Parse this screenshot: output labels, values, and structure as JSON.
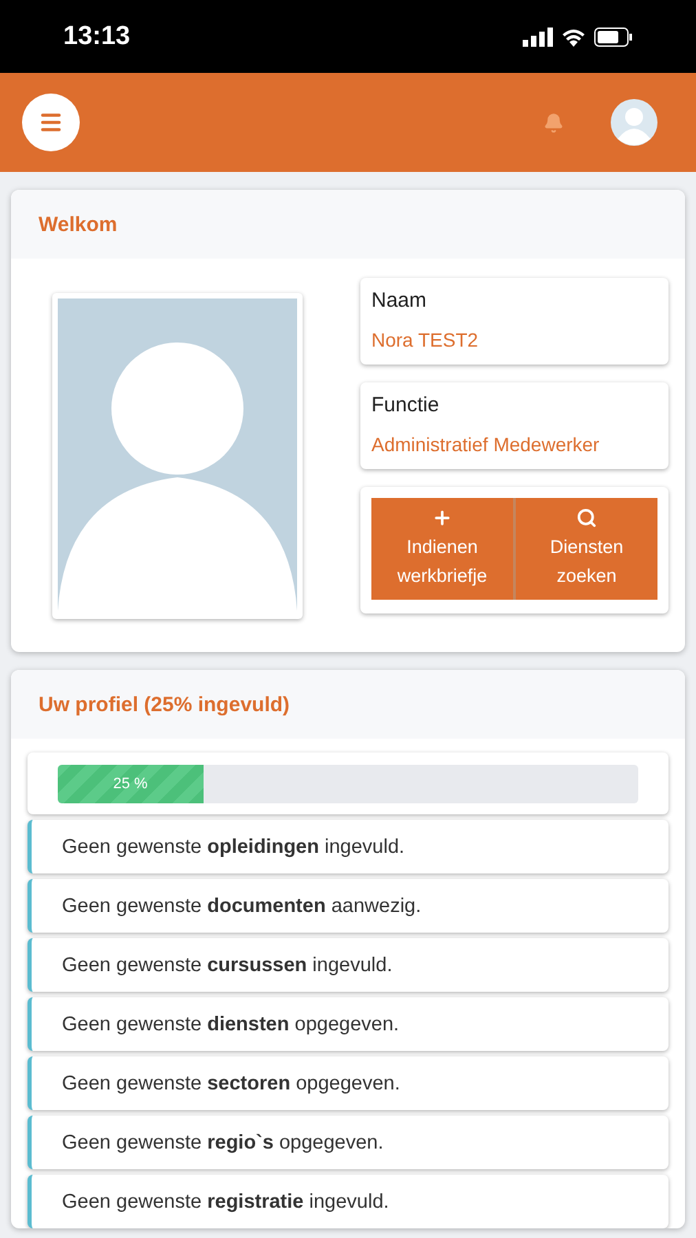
{
  "status_bar": {
    "time": "13:13"
  },
  "welcome": {
    "title": "Welkom",
    "fields": [
      {
        "label": "Naam",
        "value": "Nora TEST2"
      },
      {
        "label": "Functie",
        "value": "Administratief Medewerker"
      }
    ],
    "actions": [
      {
        "label": "Indienen werkbriefje"
      },
      {
        "label": "Diensten zoeken"
      }
    ]
  },
  "profile": {
    "title": "Uw profiel (25% ingevuld)",
    "progress": {
      "level": 0.25,
      "reading": "25 %"
    },
    "items": [
      "Geen gewenste **opleidingen** ingevuld.",
      "Geen gewenste **documenten** aanwezig.",
      "Geen gewenste **cursussen** ingevuld.",
      "Geen gewenste **diensten** opgegeven.",
      "Geen gewenste **sectoren** opgegeven.",
      "Geen gewenste **regio`s** opgegeven.",
      "Geen gewenste **registratie** ingevuld."
    ]
  }
}
